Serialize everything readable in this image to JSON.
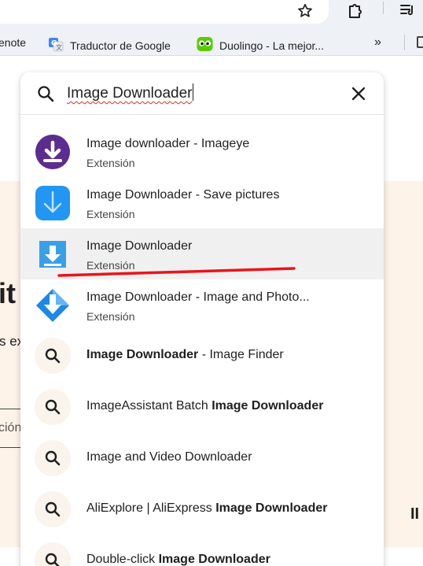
{
  "bookmarks": {
    "items": [
      {
        "label": "enote"
      },
      {
        "label": "Traductor de Google",
        "icon": "google-translate-icon"
      },
      {
        "label": "Duolingo - La mejor...",
        "icon": "duolingo-icon"
      }
    ]
  },
  "search": {
    "query": "Image Downloader"
  },
  "suggestions": [
    {
      "type": "extension",
      "title": "Image downloader - Imageye",
      "subtitle": "Extensión",
      "icon": "imageye-icon",
      "color": "#5b2d91"
    },
    {
      "type": "extension",
      "title": "Image Downloader - Save pictures",
      "subtitle": "Extensión",
      "icon": "save-pictures-icon",
      "color": "#2196f3"
    },
    {
      "type": "extension",
      "title": "Image Downloader",
      "subtitle": "Extensión",
      "icon": "image-downloader-icon",
      "color": "#3aa0e6",
      "selected": true
    },
    {
      "type": "extension",
      "title": "Image Downloader - Image and Photo...",
      "subtitle": "Extensión",
      "icon": "image-and-photo-icon",
      "color": "#1e88e5"
    },
    {
      "type": "search",
      "bold": "Image Downloader",
      "rest": " - Image Finder"
    },
    {
      "type": "search",
      "pre": "ImageAssistant Batch ",
      "bold": "Image Downloader"
    },
    {
      "type": "search",
      "pre": "Image and Video Downloader"
    },
    {
      "type": "search",
      "pre": "AliExplore | AliExpress ",
      "bold": "Image Downloader"
    },
    {
      "type": "search",
      "pre": "Double-click ",
      "bold": "Image Downloader"
    }
  ],
  "page": {
    "heading_fragment": "it",
    "text_fragment": "s ex",
    "field_fragment": "ción",
    "right_fragment": "II"
  },
  "colors": {
    "annotation_red": "#e8151b",
    "page_background": "#fdf3e8"
  }
}
